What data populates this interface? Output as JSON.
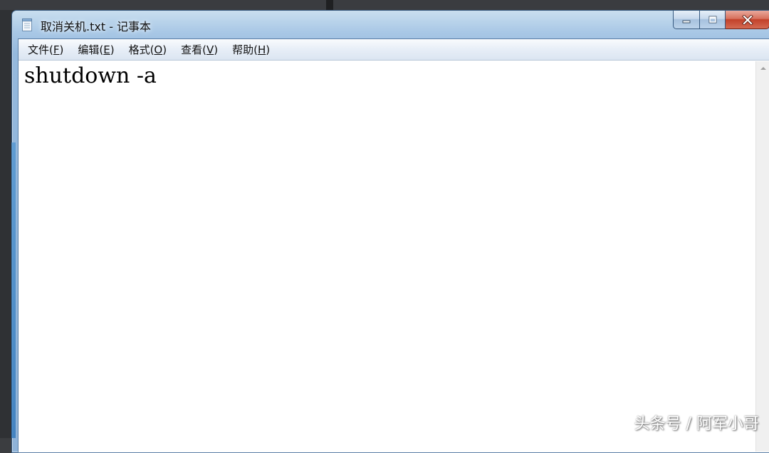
{
  "window": {
    "title": "取消关机.txt - 记事本"
  },
  "menu": [
    {
      "label": "文件(",
      "accel": "F",
      "tail": ")"
    },
    {
      "label": "编辑(",
      "accel": "E",
      "tail": ")"
    },
    {
      "label": "格式(",
      "accel": "O",
      "tail": ")"
    },
    {
      "label": "查看(",
      "accel": "V",
      "tail": ")"
    },
    {
      "label": "帮助(",
      "accel": "H",
      "tail": ")"
    }
  ],
  "editor": {
    "content": "shutdown -a"
  },
  "watermark": "头条号 / 阿军小哥",
  "icons": {
    "title": "notepad-icon",
    "minimize": "minimize-icon",
    "maximize": "maximize-icon",
    "close": "close-icon",
    "scroll_up": "scroll-up-arrow-icon"
  },
  "colors": {
    "title_gradient_top": "#c9deef",
    "close_button": "#c2412a",
    "editor_background": "#ffffff",
    "menubar_background": "#e7eef7"
  }
}
